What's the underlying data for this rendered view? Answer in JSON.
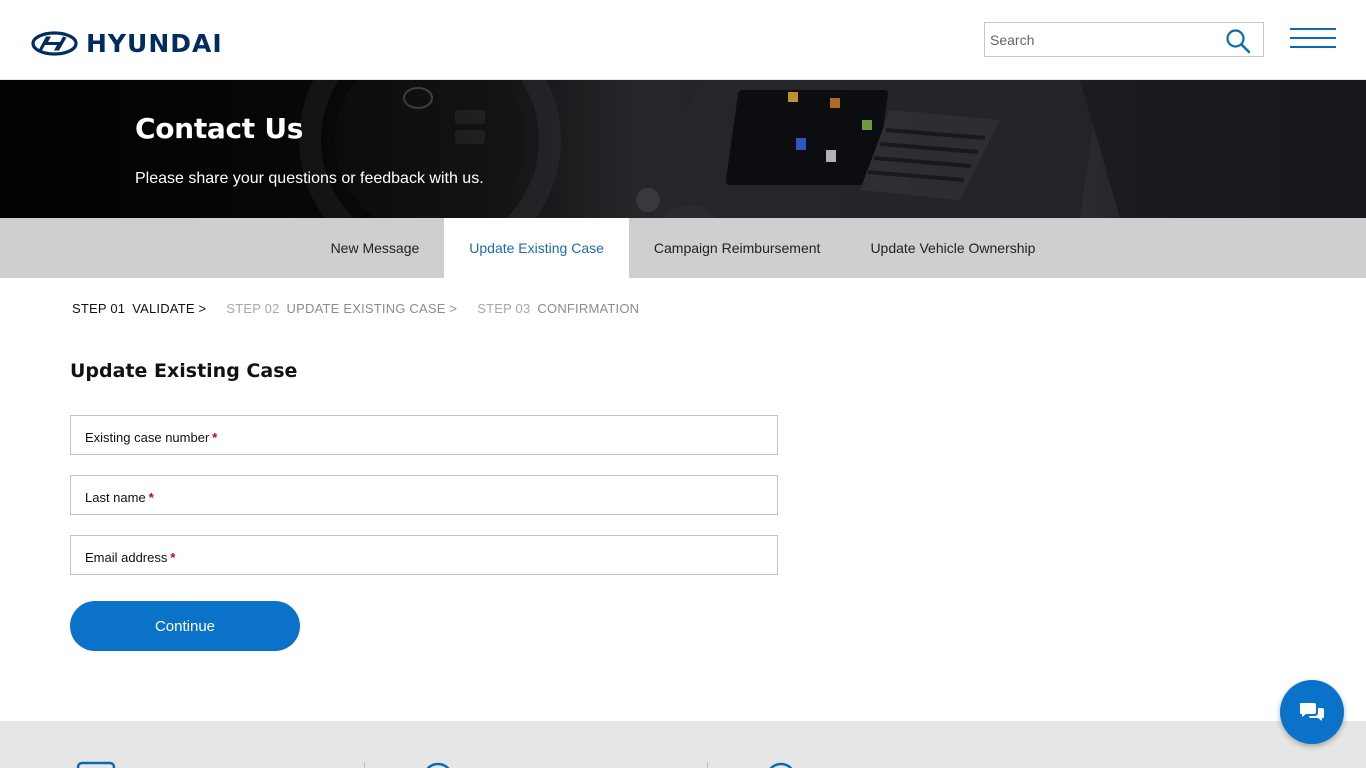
{
  "brand": {
    "name": "HYUNDAI",
    "color": "#002c5f"
  },
  "header": {
    "search_placeholder": "Search",
    "menu_icon": "hamburger-icon",
    "search_icon": "search-icon"
  },
  "hero": {
    "title": "Contact Us",
    "subtitle": "Please share your questions or feedback with us."
  },
  "tabs": [
    {
      "label": "New Message",
      "active": false
    },
    {
      "label": "Update Existing Case",
      "active": true
    },
    {
      "label": "Campaign Reimbursement",
      "active": false
    },
    {
      "label": "Update Vehicle Ownership",
      "active": false
    }
  ],
  "steps": [
    {
      "num": "STEP 01",
      "name": "VALIDATE >",
      "state": "current"
    },
    {
      "num": "STEP 02",
      "name": "UPDATE EXISTING CASE >",
      "state": "upcoming"
    },
    {
      "num": "STEP 03",
      "name": "CONFIRMATION",
      "state": "upcoming"
    }
  ],
  "form": {
    "title": "Update Existing Case",
    "fields": [
      {
        "label": "Existing case number",
        "required_mark": "*",
        "value": ""
      },
      {
        "label": "Last name",
        "required_mark": "*",
        "value": ""
      },
      {
        "label": "Email address",
        "required_mark": "*",
        "value": ""
      }
    ],
    "continue_label": "Continue"
  },
  "chat": {
    "icon": "chat-bubbles-icon"
  },
  "colors": {
    "accent": "#0a72c8",
    "tab_bar": "#cfcfcf",
    "active_tab_text": "#1d6ab0",
    "required": "#c40018",
    "footer_bg": "#e6e6e6"
  }
}
